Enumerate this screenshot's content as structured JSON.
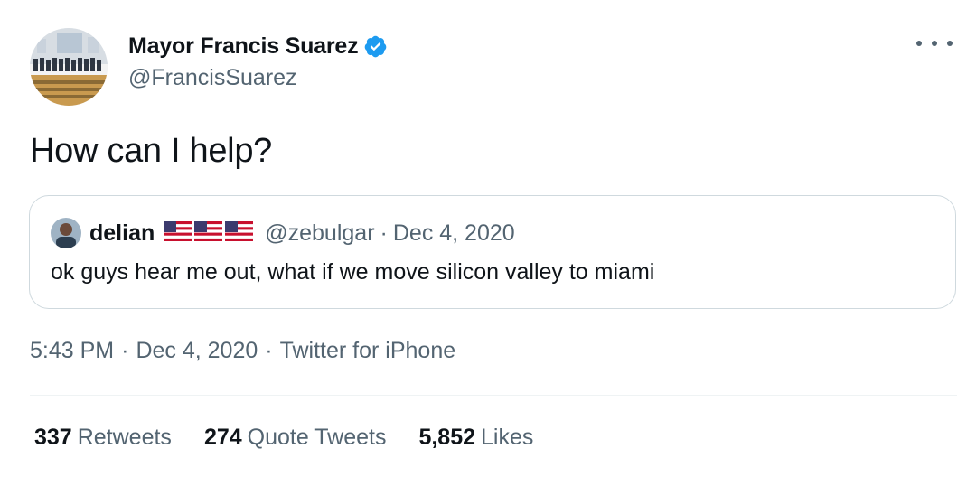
{
  "tweet": {
    "author": {
      "display_name": "Mayor Francis Suarez",
      "handle": "@FrancisSuarez",
      "verified": true,
      "verified_icon": "verified-badge-icon",
      "avatar_icon": "profile-photo"
    },
    "more_icon": "more-options-icon",
    "text": "How can I help?",
    "quoted": {
      "display_name": "delian",
      "flags": [
        "us-flag-icon",
        "us-flag-icon",
        "us-flag-icon"
      ],
      "handle": "@zebulgar",
      "separator": "·",
      "date": "Dec 4, 2020",
      "text": "ok guys hear me out, what if we move silicon valley to miami"
    },
    "meta": {
      "time": "5:43 PM",
      "date": "Dec 4, 2020",
      "source": "Twitter for iPhone",
      "separator": "·"
    },
    "stats": {
      "retweets_count": "337",
      "retweets_label": "Retweets",
      "quotes_count": "274",
      "quotes_label": "Quote Tweets",
      "likes_count": "5,852",
      "likes_label": "Likes"
    }
  },
  "colors": {
    "text_primary": "#0f1419",
    "text_secondary": "#536471",
    "verified_blue": "#1d9bf0",
    "border": "#cfd9de"
  }
}
